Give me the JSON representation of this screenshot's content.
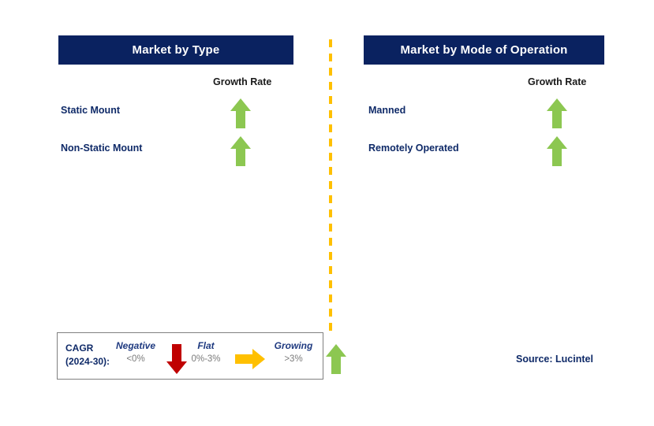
{
  "colors": {
    "navy": "#0a2260",
    "label_navy": "#0f2a68",
    "green": "#8cc751",
    "red": "#c00000",
    "yellow": "#ffc000",
    "gray_value": "#7b7b7b",
    "legend_border": "#808080"
  },
  "panels": [
    {
      "id": "market-by-type",
      "title": "Market by Type",
      "column_header": "Growth Rate",
      "rows": [
        {
          "label": "Static Mount",
          "arrow": "arrow-up-icon",
          "arrow_color": "#8cc751"
        },
        {
          "label": "Non-Static Mount",
          "arrow": "arrow-up-icon",
          "arrow_color": "#8cc751"
        }
      ]
    },
    {
      "id": "market-by-mode-of-operation",
      "title": "Market by Mode of Operation",
      "column_header": "Growth Rate",
      "rows": [
        {
          "label": "Manned",
          "arrow": "arrow-up-icon",
          "arrow_color": "#8cc751"
        },
        {
          "label": "Remotely Operated",
          "arrow": "arrow-up-icon",
          "arrow_color": "#8cc751"
        }
      ]
    }
  ],
  "legend": {
    "title_line1": "CAGR",
    "title_line2": "(2024-30):",
    "items": [
      {
        "name": "Negative",
        "value": "<0%",
        "arrow": "arrow-down-icon",
        "arrow_color": "#c00000"
      },
      {
        "name": "Flat",
        "value": "0%-3%",
        "arrow": "arrow-right-icon",
        "arrow_color": "#ffc000"
      },
      {
        "name": "Growing",
        "value": ">3%",
        "arrow": "arrow-up-icon",
        "arrow_color": "#8cc751"
      }
    ]
  },
  "source": "Source: Lucintel"
}
